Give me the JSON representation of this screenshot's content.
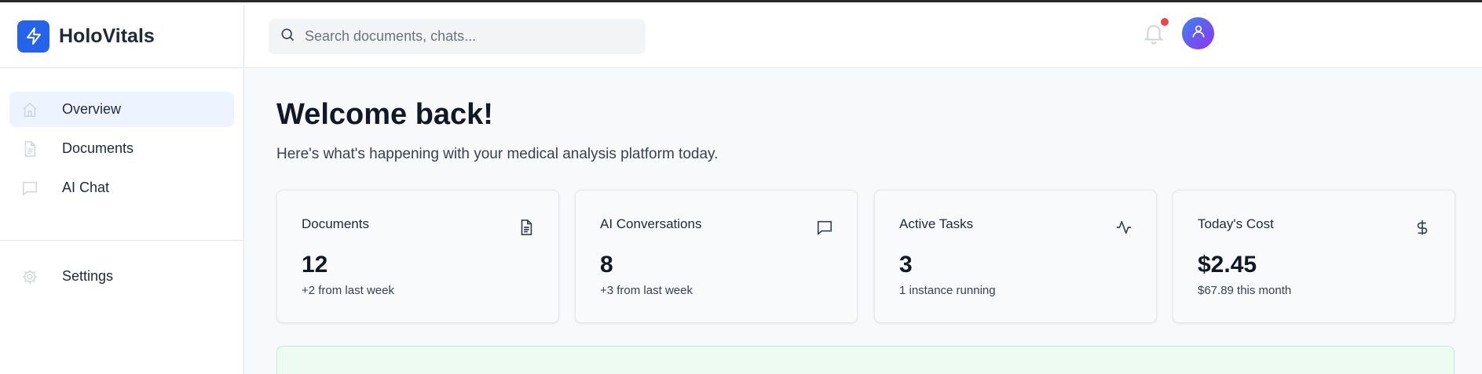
{
  "brand": {
    "name": "HoloVitals",
    "icon": "lightning-bolt-icon",
    "accent": "#2563eb"
  },
  "sidebar": {
    "items": [
      {
        "label": "Overview",
        "icon": "home-icon",
        "active": true
      },
      {
        "label": "Documents",
        "icon": "document-icon",
        "active": false
      },
      {
        "label": "AI Chat",
        "icon": "chat-icon",
        "active": false
      }
    ],
    "secondary": [
      {
        "label": "Settings",
        "icon": "gear-icon",
        "active": false
      }
    ]
  },
  "header": {
    "search_placeholder": "Search documents, chats...",
    "notification_indicator_color": "#ef4444",
    "avatar_icon": "user-icon"
  },
  "main": {
    "title": "Welcome back!",
    "subtitle": "Here's what's happening with your medical analysis platform today."
  },
  "stats": [
    {
      "title": "Documents",
      "value": "12",
      "note": "+2 from last week",
      "icon": "document-icon"
    },
    {
      "title": "AI Conversations",
      "value": "8",
      "note": "+3 from last week",
      "icon": "chat-icon"
    },
    {
      "title": "Active Tasks",
      "value": "3",
      "note": "1 instance running",
      "icon": "activity-icon"
    },
    {
      "title": "Today's Cost",
      "value": "$2.45",
      "note": "$67.89 this month",
      "icon": "dollar-icon"
    }
  ]
}
